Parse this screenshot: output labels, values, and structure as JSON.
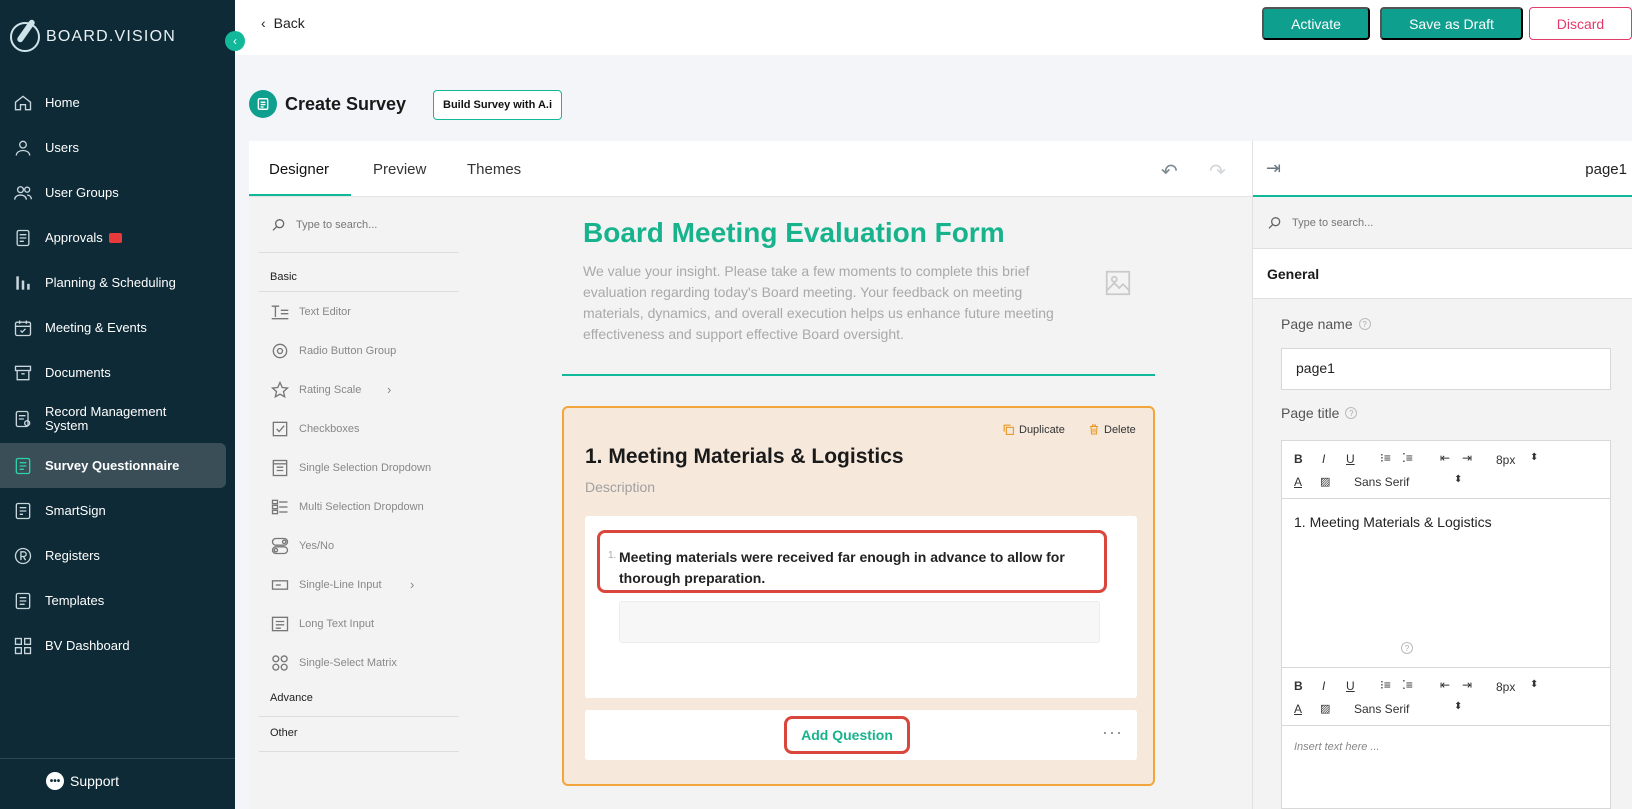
{
  "brand": {
    "name": "BOARD.VISION"
  },
  "sidebar": {
    "items": [
      {
        "label": "Home",
        "icon": "home-icon"
      },
      {
        "label": "Users",
        "icon": "user-icon"
      },
      {
        "label": "User Groups",
        "icon": "users-icon"
      },
      {
        "label": "Approvals",
        "icon": "document-icon"
      },
      {
        "label": "Planning & Scheduling",
        "icon": "bar-chart-icon"
      },
      {
        "label": "Meeting & Events",
        "icon": "calendar-icon"
      },
      {
        "label": "Documents",
        "icon": "archive-icon"
      },
      {
        "label": "Record Management System",
        "icon": "record-icon"
      },
      {
        "label": "Survey Questionnaire",
        "icon": "survey-icon",
        "active": true
      },
      {
        "label": "SmartSign",
        "icon": "sign-icon"
      },
      {
        "label": "Registers",
        "icon": "registered-icon"
      },
      {
        "label": "Templates",
        "icon": "template-icon"
      },
      {
        "label": "BV Dashboard",
        "icon": "grid-icon"
      }
    ],
    "support_label": "Support"
  },
  "topbar": {
    "back_label": "Back",
    "activate_label": "Activate",
    "save_draft_label": "Save as Draft",
    "discard_label": "Discard"
  },
  "page": {
    "title": "Create Survey",
    "ai_button_label": "Build Survey with A.i"
  },
  "designer": {
    "tabs": [
      "Designer",
      "Preview",
      "Themes"
    ],
    "active_tab": "Designer"
  },
  "toolbox": {
    "search_placeholder": "Type to search...",
    "groups": {
      "basic": "Basic",
      "advance": "Advance",
      "other": "Other"
    },
    "items": [
      {
        "label": "Text Editor",
        "icon": "text-editor-icon"
      },
      {
        "label": "Radio Button Group",
        "icon": "radio-icon"
      },
      {
        "label": "Rating Scale",
        "icon": "star-icon",
        "has_submenu": true
      },
      {
        "label": "Checkboxes",
        "icon": "checkbox-icon"
      },
      {
        "label": "Single Selection Dropdown",
        "icon": "dropdown-icon"
      },
      {
        "label": "Multi Selection Dropdown",
        "icon": "multi-dropdown-icon"
      },
      {
        "label": "Yes/No",
        "icon": "toggle-icon"
      },
      {
        "label": "Single-Line Input",
        "icon": "input-icon",
        "has_submenu": true
      },
      {
        "label": "Long Text Input",
        "icon": "long-text-icon"
      },
      {
        "label": "Single-Select Matrix",
        "icon": "matrix-icon"
      }
    ]
  },
  "survey": {
    "title": "Board Meeting Evaluation Form",
    "description": "We value your insight. Please take a few moments to complete this brief evaluation regarding today's Board meeting. Your feedback on meeting materials, dynamics, and overall execution helps us enhance future meeting effectiveness and support effective Board oversight.",
    "page": {
      "title": "1. Meeting Materials & Logistics",
      "description": "Description",
      "duplicate_label": "Duplicate",
      "delete_label": "Delete",
      "question_number": "1.",
      "question_text": "Meeting materials were received far enough in advance to allow for thorough preparation.",
      "add_question_label": "Add Question",
      "more_label": "···"
    }
  },
  "properties": {
    "header_label": "page1",
    "search_placeholder": "Type to search...",
    "section": "General",
    "page_name_label": "Page name",
    "page_name_value": "page1",
    "page_title_label": "Page title",
    "editor": {
      "font_size": "8px",
      "font_family": "Sans Serif",
      "content": "1. Meeting Materials & Logistics",
      "placeholder": "Insert text here ..."
    }
  },
  "colors": {
    "accent": "#12b89a",
    "button": "#0f9f8f",
    "sidebar": "#0e2a36",
    "discard": "#e03a6a",
    "highlight": "#d9463b",
    "page_border": "#f2a53a"
  }
}
